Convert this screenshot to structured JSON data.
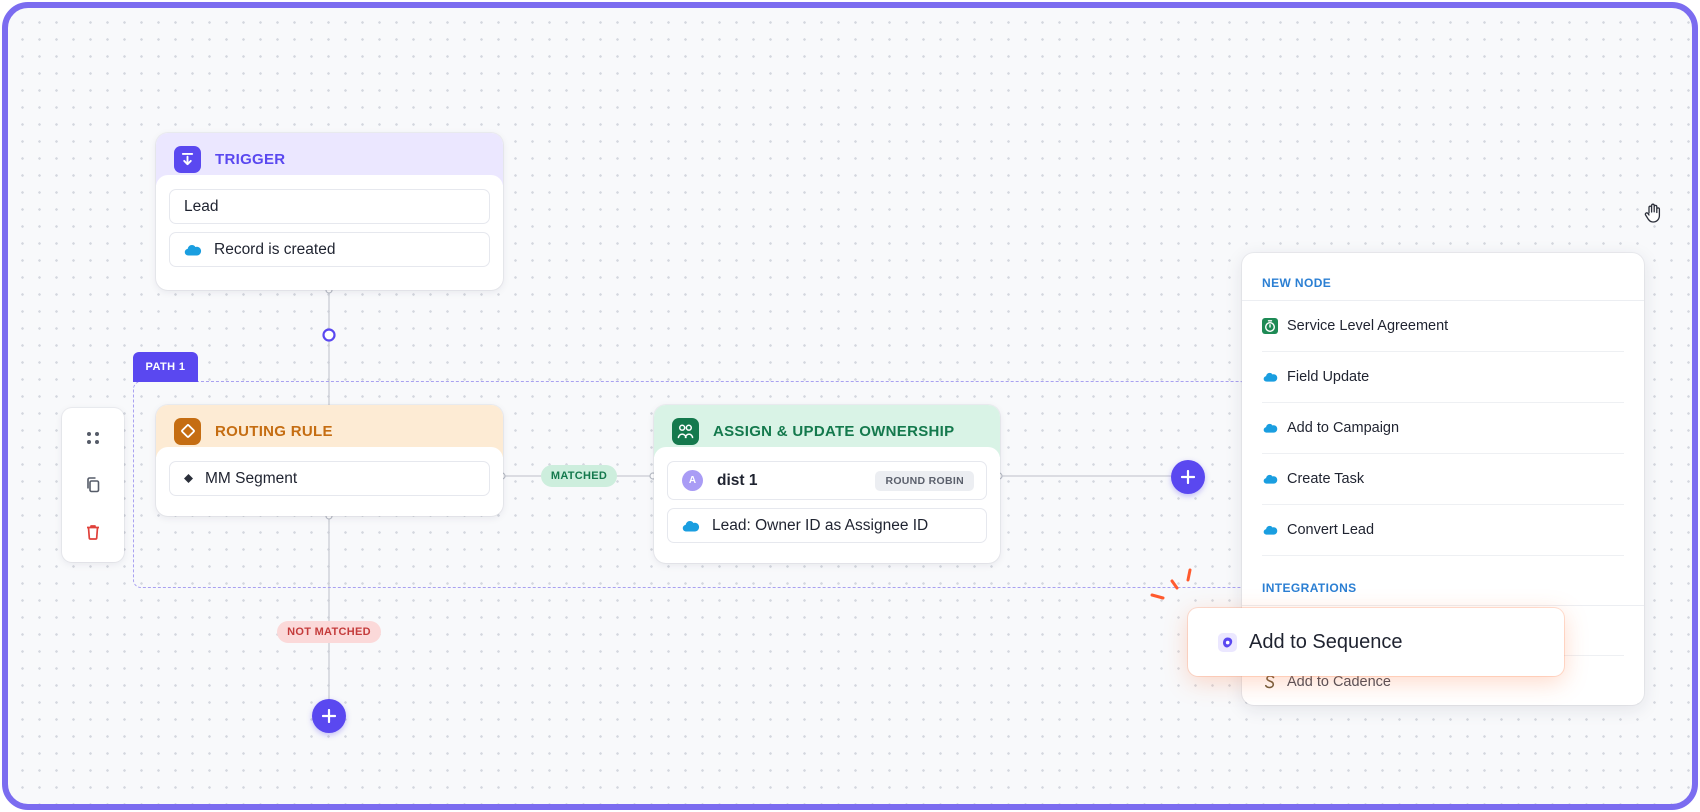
{
  "path": {
    "label": "PATH 1"
  },
  "trigger": {
    "title": "TRIGGER",
    "object": "Lead",
    "event": "Record is created"
  },
  "routing_rule": {
    "title": "ROUTING RULE",
    "segment": "MM Segment"
  },
  "assign": {
    "title": "ASSIGN & UPDATE OWNERSHIP",
    "avatar_initial": "A",
    "distribution": "dist 1",
    "method": "ROUND ROBIN",
    "field": "Lead: Owner ID as Assignee ID"
  },
  "edges": {
    "matched": "MATCHED",
    "not_matched": "NOT MATCHED"
  },
  "menu": {
    "new_node_header": "NEW NODE",
    "new_node_items": [
      {
        "label": "Service Level Agreement",
        "icon": "sla-timer-icon"
      },
      {
        "label": "Field Update",
        "icon": "salesforce-cloud-icon"
      },
      {
        "label": "Add to Campaign",
        "icon": "salesforce-cloud-icon"
      },
      {
        "label": "Create Task",
        "icon": "salesforce-cloud-icon"
      },
      {
        "label": "Convert Lead",
        "icon": "salesforce-cloud-icon"
      }
    ],
    "integrations_header": "INTEGRATIONS",
    "integration_items": [
      {
        "label": "Add to Cadence",
        "icon": "salesloft-s-icon"
      }
    ]
  },
  "drag_popup": {
    "label": "Add to Sequence",
    "icon": "outreach-icon"
  },
  "colors": {
    "accent": "#5a48f0",
    "trigger": "#5a48f0",
    "routing": "#c56d12",
    "assign": "#14794d",
    "salesforce": "#1a9ee0"
  }
}
